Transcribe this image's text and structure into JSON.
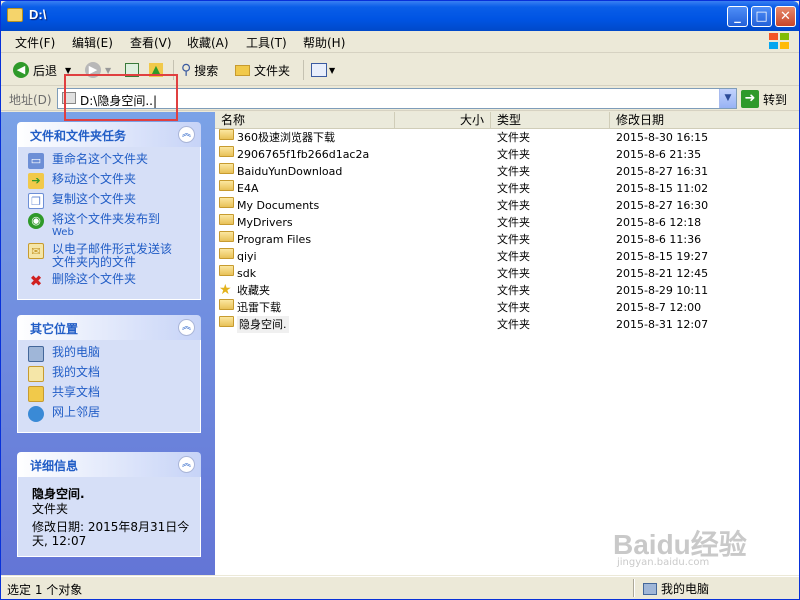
{
  "window": {
    "title": "D:\\",
    "controls": {
      "minimize": "_",
      "maximize": "□",
      "close": "✕"
    }
  },
  "menubar": {
    "items": [
      "文件(F)",
      "编辑(E)",
      "查看(V)",
      "收藏(A)",
      "工具(T)",
      "帮助(H)"
    ]
  },
  "toolbar": {
    "back_label": "后退",
    "search_label": "搜索",
    "folders_label": "文件夹"
  },
  "addressbar": {
    "label": "地址(D)",
    "value": "D:\\隐身空间..|",
    "go_label": "转到"
  },
  "left_pane": {
    "tasks_panel": {
      "title": "文件和文件夹任务",
      "items": [
        {
          "label": "重命名这个文件夹",
          "icon": "rename-icon"
        },
        {
          "label": "移动这个文件夹",
          "icon": "move-icon"
        },
        {
          "label": "复制这个文件夹",
          "icon": "copy-icon"
        },
        {
          "label": "将这个文件夹发布到",
          "label2": "Web",
          "icon": "publish-web-icon"
        },
        {
          "label": "以电子邮件形式发送该",
          "label2": "文件夹内的文件",
          "icon": "email-icon"
        },
        {
          "label": "删除这个文件夹",
          "icon": "delete-icon"
        }
      ]
    },
    "places_panel": {
      "title": "其它位置",
      "items": [
        {
          "label": "我的电脑",
          "icon": "my-computer-icon"
        },
        {
          "label": "我的文档",
          "icon": "my-documents-icon"
        },
        {
          "label": "共享文档",
          "icon": "shared-documents-icon"
        },
        {
          "label": "网上邻居",
          "icon": "network-places-icon"
        }
      ]
    },
    "details_panel": {
      "title": "详细信息",
      "name": "隐身空间.",
      "type": "文件夹",
      "modified_line1": "修改日期: 2015年8月31日今",
      "modified_line2": "天, 12:07"
    }
  },
  "file_list": {
    "columns": [
      "名称",
      "大小",
      "类型",
      "修改日期"
    ],
    "rows": [
      {
        "name": "360极速浏览器下载",
        "size": "",
        "type": "文件夹",
        "modified": "2015-8-30 16:15",
        "icon": "folder-icon"
      },
      {
        "name": "2906765f1fb266d1ac2a",
        "size": "",
        "type": "文件夹",
        "modified": "2015-8-6 21:35",
        "icon": "folder-icon"
      },
      {
        "name": "BaiduYunDownload",
        "size": "",
        "type": "文件夹",
        "modified": "2015-8-27 16:31",
        "icon": "folder-icon"
      },
      {
        "name": "E4A",
        "size": "",
        "type": "文件夹",
        "modified": "2015-8-15 11:02",
        "icon": "folder-icon"
      },
      {
        "name": "My Documents",
        "size": "",
        "type": "文件夹",
        "modified": "2015-8-27 16:30",
        "icon": "folder-icon"
      },
      {
        "name": "MyDrivers",
        "size": "",
        "type": "文件夹",
        "modified": "2015-8-6 12:18",
        "icon": "folder-icon"
      },
      {
        "name": "Program Files",
        "size": "",
        "type": "文件夹",
        "modified": "2015-8-6 11:36",
        "icon": "folder-icon"
      },
      {
        "name": "qiyi",
        "size": "",
        "type": "文件夹",
        "modified": "2015-8-15 19:27",
        "icon": "folder-icon"
      },
      {
        "name": "sdk",
        "size": "",
        "type": "文件夹",
        "modified": "2015-8-21 12:45",
        "icon": "folder-icon"
      },
      {
        "name": "收藏夹",
        "size": "",
        "type": "文件夹",
        "modified": "2015-8-29 10:11",
        "icon": "favorites-star-icon"
      },
      {
        "name": "迅雷下载",
        "size": "",
        "type": "文件夹",
        "modified": "2015-8-7 12:00",
        "icon": "folder-icon"
      },
      {
        "name": "隐身空间.",
        "size": "",
        "type": "文件夹",
        "modified": "2015-8-31 12:07",
        "icon": "folder-icon"
      }
    ]
  },
  "statusbar": {
    "left": "选定 1 个对象",
    "right": "我的电脑"
  },
  "watermark": {
    "main": "Baidu经验",
    "sub": "jingyan.baidu.com"
  },
  "colors": {
    "titlebar": "#0054e3",
    "task_text": "#215dc6",
    "highlight_box": "#e04040"
  }
}
